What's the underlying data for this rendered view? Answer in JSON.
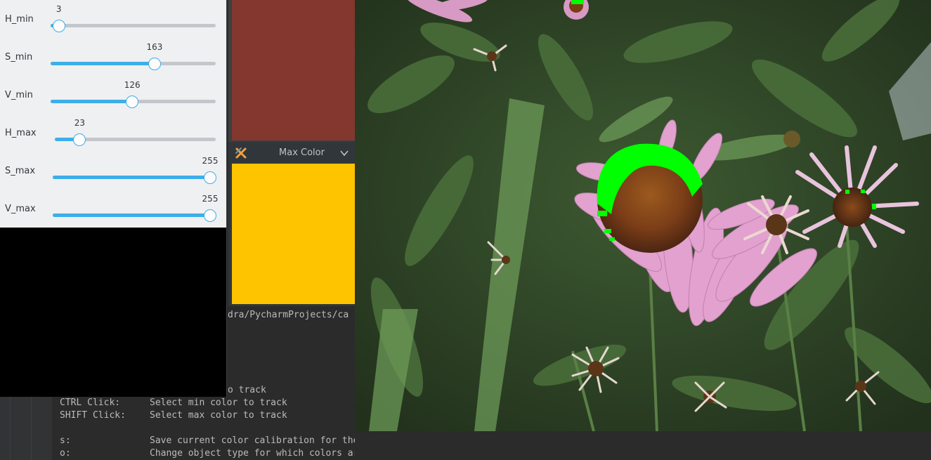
{
  "trackbars": [
    {
      "label": "H_min",
      "value": 3,
      "max": 179
    },
    {
      "label": "S_min",
      "value": 163,
      "max": 255
    },
    {
      "label": "V_min",
      "value": 126,
      "max": 255
    },
    {
      "label": "H_max",
      "value": 23,
      "max": 179
    },
    {
      "label": "S_max",
      "value": 255,
      "max": 255
    },
    {
      "label": "V_max",
      "value": 255,
      "max": 255
    }
  ],
  "min_color_window": {
    "swatch_color": "#83372f"
  },
  "max_color_window": {
    "title": "Max Color",
    "swatch_color": "#ffc400",
    "app_icon": "opencv-window-icon",
    "collapse_icon": "chevron-down-icon",
    "close_icon": "close-icon"
  },
  "terminal": {
    "path_fragment": "dra/PycharmProjects/ca",
    "fragment_line": "o track",
    "shortcuts": [
      {
        "key": "CTRL Click:",
        "desc": "Select min color to track"
      },
      {
        "key": "SHIFT Click:",
        "desc": "Select max color to track"
      },
      {
        "key": "s:",
        "desc": "Save current color calibration for the object"
      },
      {
        "key": "o:",
        "desc": "Change object type for which colors are calibrated"
      }
    ]
  },
  "image_window": {
    "subject": "echinacea flowers with green highlighted detection mask",
    "mask_color": "#00ff00"
  }
}
